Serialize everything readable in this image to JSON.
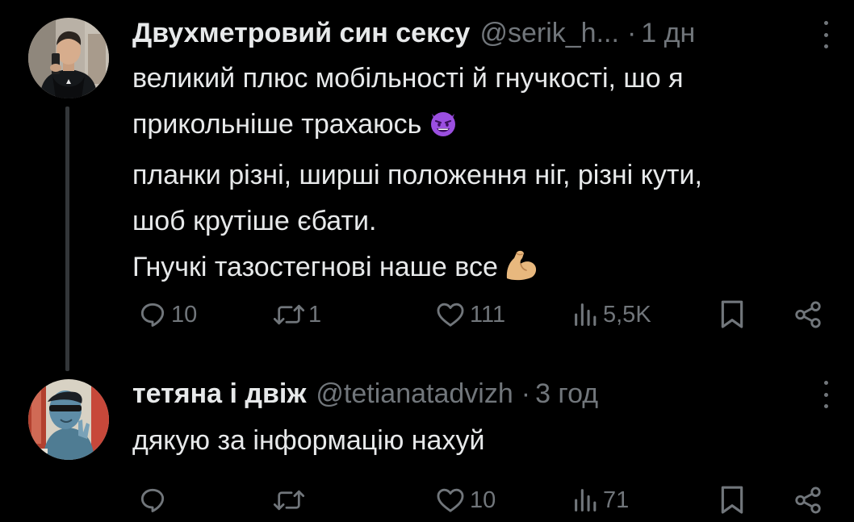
{
  "tweets": [
    {
      "author": {
        "display_name": "Двухметровий син сексу",
        "handle": "@serik_h...",
        "avatar_icon": "avatar-photo-man"
      },
      "separator": "·",
      "time": "1 дн",
      "text_lines": [
        "великий плюс мобільності й гнучкості, шо я",
        "прикольніше трахаюсь",
        "планки різні, ширші положення ніг, різні кути,",
        "шоб крутіше єбати.",
        "Гнучкі тазостегнові наше все"
      ],
      "emojis": [
        "smiling-devil-emoji",
        "flexed-biceps-emoji"
      ],
      "stats": {
        "replies": "10",
        "reposts": "1",
        "likes": "111",
        "views": "5,5K"
      }
    },
    {
      "author": {
        "display_name": "тетяна і двіж",
        "handle": "@tetianatadvizh",
        "avatar_icon": "avatar-painting"
      },
      "separator": "·",
      "time": "3 год",
      "text_lines": [
        "дякую за інформацію нахуй"
      ],
      "stats": {
        "replies": "",
        "reposts": "",
        "likes": "10",
        "views": "71"
      }
    }
  ],
  "icons": [
    "reply-icon",
    "repost-icon",
    "like-icon",
    "views-icon",
    "bookmark-icon",
    "share-icon",
    "more-icon"
  ],
  "colors": {
    "background": "#000000",
    "text_primary": "#e7e9ea",
    "text_secondary": "#71767b",
    "thread_line": "#333639"
  }
}
